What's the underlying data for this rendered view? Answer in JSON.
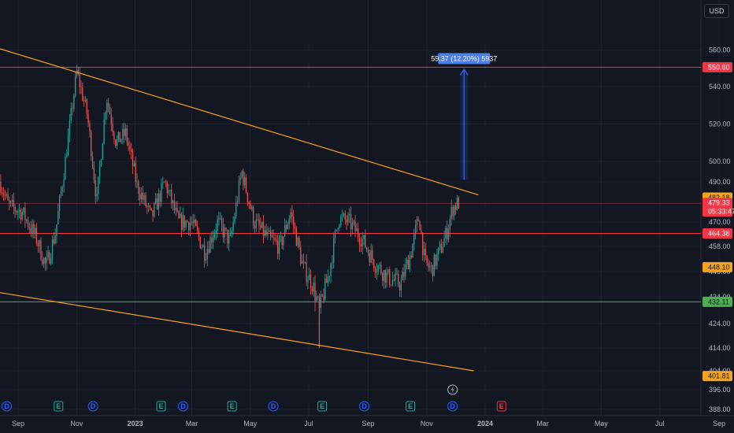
{
  "toolbar": {
    "currency": "USD"
  },
  "colors": {
    "background": "#131722",
    "grid": "#1e222d",
    "up": "#26a69a",
    "down": "#ef5350",
    "resistance": "#f23645",
    "support": "#4caf50",
    "trendline": "#f7a21b",
    "measure": "#2962ff"
  },
  "chart_data": {
    "type": "candlestick",
    "y_axis": {
      "range": [
        386,
        570
      ],
      "ticks": [
        {
          "value": 560,
          "label": "560.00"
        },
        {
          "value": 540,
          "label": "540.00"
        },
        {
          "value": 520,
          "label": "520.00"
        },
        {
          "value": 500,
          "label": "500.00"
        },
        {
          "value": 490,
          "label": "490.00"
        },
        {
          "value": 470,
          "label": "470.00"
        },
        {
          "value": 458,
          "label": "458.00"
        },
        {
          "value": 446,
          "label": "446.00"
        },
        {
          "value": 434,
          "label": "434.00"
        },
        {
          "value": 424,
          "label": "424.00"
        },
        {
          "value": 414,
          "label": "414.00"
        },
        {
          "value": 404,
          "label": "404.00"
        },
        {
          "value": 396,
          "label": "396.00"
        },
        {
          "value": 388,
          "label": "388.00"
        }
      ]
    },
    "x_axis": {
      "ticks": [
        {
          "date": "2022-09-01",
          "label": "Sep",
          "bold": false
        },
        {
          "date": "2022-11-01",
          "label": "Nov",
          "bold": false
        },
        {
          "date": "2023-01-01",
          "label": "2023",
          "bold": true
        },
        {
          "date": "2023-03-01",
          "label": "Mar",
          "bold": false
        },
        {
          "date": "2023-05-01",
          "label": "May",
          "bold": false
        },
        {
          "date": "2023-07-01",
          "label": "Jul",
          "bold": false
        },
        {
          "date": "2023-09-01",
          "label": "Sep",
          "bold": false
        },
        {
          "date": "2023-11-01",
          "label": "Nov",
          "bold": false
        },
        {
          "date": "2024-01-01",
          "label": "2024",
          "bold": true
        },
        {
          "date": "2024-03-01",
          "label": "Mar",
          "bold": false
        },
        {
          "date": "2024-05-01",
          "label": "May",
          "bold": false
        },
        {
          "date": "2024-07-01",
          "label": "Jul",
          "bold": false
        },
        {
          "date": "2024-09-01",
          "label": "Sep",
          "bold": false
        }
      ]
    },
    "series_path": [
      [
        "2022-08-13",
        490
      ],
      [
        "2022-08-22",
        478
      ],
      [
        "2022-09-05",
        475
      ],
      [
        "2022-09-20",
        462
      ],
      [
        "2022-09-30",
        448
      ],
      [
        "2022-10-10",
        465
      ],
      [
        "2022-10-20",
        500
      ],
      [
        "2022-11-01",
        548
      ],
      [
        "2022-11-12",
        525
      ],
      [
        "2022-11-22",
        480
      ],
      [
        "2022-12-02",
        535
      ],
      [
        "2022-12-12",
        510
      ],
      [
        "2022-12-22",
        515
      ],
      [
        "2023-01-03",
        488
      ],
      [
        "2023-01-18",
        472
      ],
      [
        "2023-02-01",
        490
      ],
      [
        "2023-02-15",
        470
      ],
      [
        "2023-03-01",
        470
      ],
      [
        "2023-03-15",
        455
      ],
      [
        "2023-03-28",
        470
      ],
      [
        "2023-04-10",
        460
      ],
      [
        "2023-04-22",
        495
      ],
      [
        "2023-05-05",
        470
      ],
      [
        "2023-05-20",
        462
      ],
      [
        "2023-06-01",
        458
      ],
      [
        "2023-06-12",
        475
      ],
      [
        "2023-06-25",
        448
      ],
      [
        "2023-07-05",
        440
      ],
      [
        "2023-07-12",
        428
      ],
      [
        "2023-07-22",
        445
      ],
      [
        "2023-08-01",
        472
      ],
      [
        "2023-08-12",
        470
      ],
      [
        "2023-08-25",
        462
      ],
      [
        "2023-09-08",
        450
      ],
      [
        "2023-09-22",
        443
      ],
      [
        "2023-10-05",
        440
      ],
      [
        "2023-10-16",
        456
      ],
      [
        "2023-10-24",
        473
      ],
      [
        "2023-10-30",
        450
      ],
      [
        "2023-11-06",
        447
      ],
      [
        "2023-11-15",
        456
      ],
      [
        "2023-11-22",
        465
      ],
      [
        "2023-11-28",
        477
      ],
      [
        "2023-12-05",
        480
      ]
    ],
    "candle_count": 320,
    "horizontal_levels": [
      {
        "name": "resistance",
        "value": 550.6,
        "color": "#f23645"
      },
      {
        "name": "mid-resistance",
        "value": 479.33,
        "color": "#f23645"
      },
      {
        "name": "support-upper",
        "value": 464.38,
        "color": "#f23645"
      },
      {
        "name": "support-lower",
        "value": 432.11,
        "color": "#4caf50"
      }
    ],
    "trendlines": [
      {
        "name": "upper-trendline",
        "from": [
          "2022-08-13",
          560.6
        ],
        "to": [
          "2023-12-25",
          483.5
        ]
      },
      {
        "name": "lower-trendline",
        "from": [
          "2022-08-13",
          436.0
        ],
        "to": [
          "2023-12-20",
          404.0
        ]
      }
    ],
    "measure": {
      "from": [
        "2023-12-10",
        491
      ],
      "to": [
        "2023-12-10",
        550.6
      ],
      "label": "59.37 (12.20%) 5937"
    },
    "price_tags": [
      {
        "value": 550.6,
        "label": "550.60",
        "bg": "#f23645",
        "fg": "#ffffff"
      },
      {
        "value": 482.18,
        "label": "482.18",
        "bg": "#f7a21b",
        "fg": "#131722"
      },
      {
        "value": 479.33,
        "label": "479.33",
        "label2": "05:33:47",
        "bg": "#f23645",
        "fg": "#ffffff"
      },
      {
        "value": 464.38,
        "label": "464.38",
        "bg": "#f23645",
        "fg": "#ffffff"
      },
      {
        "value": 448.1,
        "label": "448.10",
        "bg": "#f7a21b",
        "fg": "#131722"
      },
      {
        "value": 432.11,
        "label": "432.11",
        "bg": "#4caf50",
        "fg": "#131722"
      },
      {
        "value": 401.81,
        "label": "401.81",
        "bg": "#f7a21b",
        "fg": "#131722"
      }
    ],
    "events": [
      {
        "date": "2022-08-20",
        "type": "D",
        "color": "#2962ff"
      },
      {
        "date": "2022-10-13",
        "type": "E",
        "color": "#26a69a"
      },
      {
        "date": "2022-11-18",
        "type": "D",
        "color": "#2962ff"
      },
      {
        "date": "2023-01-28",
        "type": "E",
        "color": "#26a69a"
      },
      {
        "date": "2023-02-20",
        "type": "D",
        "color": "#2962ff"
      },
      {
        "date": "2023-04-12",
        "type": "E",
        "color": "#26a69a"
      },
      {
        "date": "2023-05-25",
        "type": "D",
        "color": "#2962ff"
      },
      {
        "date": "2023-07-15",
        "type": "E",
        "color": "#26a69a"
      },
      {
        "date": "2023-08-28",
        "type": "D",
        "color": "#2962ff"
      },
      {
        "date": "2023-10-15",
        "type": "E",
        "color": "#26a69a"
      },
      {
        "date": "2023-11-28",
        "type": "D",
        "color": "#2962ff"
      },
      {
        "date": "2024-01-18",
        "type": "E",
        "color": "#f23645"
      }
    ],
    "lightning_marker": {
      "date": "2023-11-28"
    },
    "grid": true,
    "legend": "none"
  }
}
